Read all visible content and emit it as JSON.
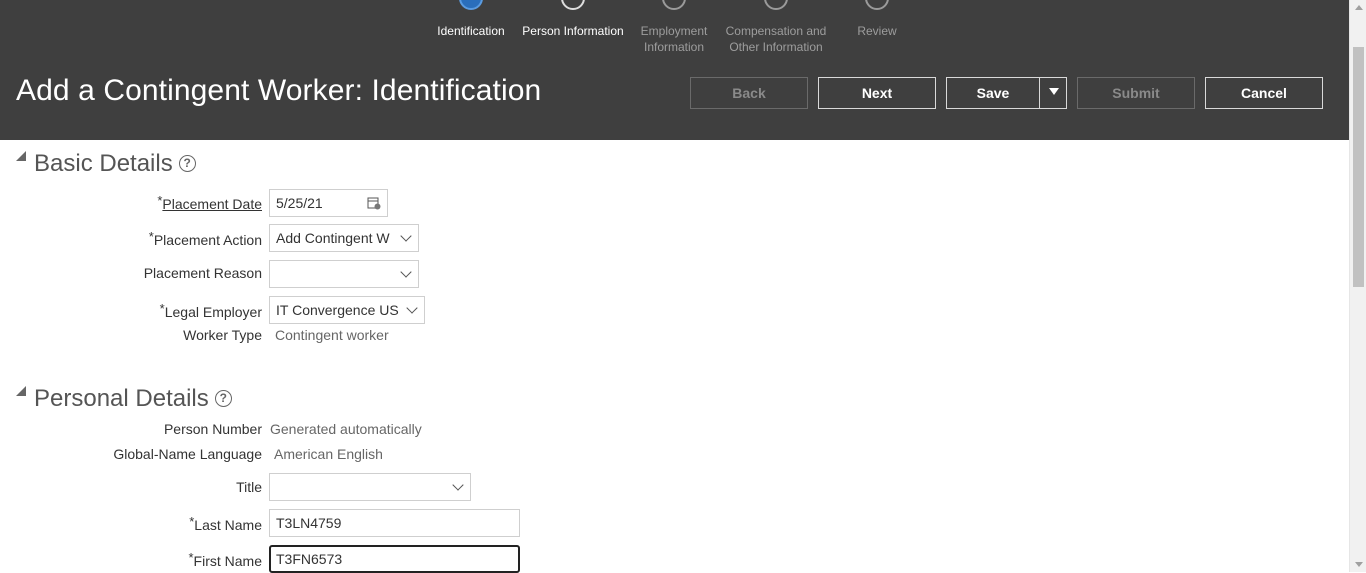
{
  "train": {
    "steps": [
      {
        "label": "Identification",
        "state": "current"
      },
      {
        "label": "Person Information",
        "state": "visited"
      },
      {
        "label": "Employment Information",
        "state": "pending"
      },
      {
        "label": "Compensation and Other Information",
        "state": "pending"
      },
      {
        "label": "Review",
        "state": "pending"
      }
    ]
  },
  "header": {
    "title": "Add a Contingent Worker: Identification",
    "buttons": {
      "back": "Back",
      "next": "Next",
      "save": "Save",
      "submit": "Submit",
      "cancel": "Cancel"
    }
  },
  "basic_details": {
    "heading": "Basic Details",
    "placement_date_label": "Placement Date",
    "placement_date_value": "5/25/21",
    "placement_action_label": "Placement Action",
    "placement_action_value": "Add Contingent W",
    "placement_reason_label": "Placement Reason",
    "placement_reason_value": "",
    "legal_employer_label": "Legal Employer",
    "legal_employer_value": "IT Convergence US",
    "worker_type_label": "Worker Type",
    "worker_type_value": "Contingent worker"
  },
  "personal_details": {
    "heading": "Personal Details",
    "person_number_label": "Person Number",
    "person_number_value": "Generated automatically",
    "global_name_language_label": "Global-Name Language",
    "global_name_language_value": "American English",
    "title_label": "Title",
    "title_value": "",
    "last_name_label": "Last Name",
    "last_name_value": "T3LN4759",
    "first_name_label": "First Name",
    "first_name_value": "T3FN6573"
  },
  "required_marker": "*",
  "help_glyph": "?"
}
